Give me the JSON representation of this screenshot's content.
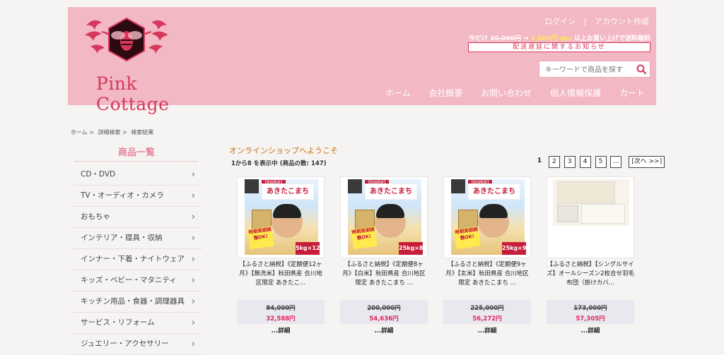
{
  "header": {
    "brand": "Pink Cottage",
    "login": "ログイン",
    "separator": "|",
    "create_account": "アカウント作成",
    "shipping_prefix": "今だけ",
    "shipping_old": "10,000円",
    "shipping_plus": "→",
    "shipping_new": "1,500円",
    "shipping_tax": "(税込)",
    "shipping_suffix": "以上お買い上げで送料無料",
    "delay_notice": "配送遅延に関するお知らせ",
    "search_placeholder": "キーワードで商品を探す",
    "nav": [
      "ホーム",
      "会社概要",
      "お問い合わせ",
      "個人情報保護",
      "カート"
    ]
  },
  "breadcrumb": [
    "ホーム >",
    "詳細検索 >",
    "検索結果"
  ],
  "sidebar": {
    "title": "商品一覧",
    "items": [
      "CD・DVD",
      "TV・オーディオ・カメラ",
      "おもちゃ",
      "インテリア・寝具・収納",
      "インナー・下着・ナイトウェア",
      "キッズ・ベビー・マタニティ",
      "キッチン用品・食器・調理器具",
      "サービス・リフォーム",
      "ジュエリー・アクセサリー"
    ],
    "arrow": "›"
  },
  "main": {
    "welcome": "オンラインショップへようこそ",
    "count": "1から8 を表示中 (商品の数: 147)",
    "pager": {
      "current": "1",
      "pages": [
        "2",
        "3",
        "4",
        "5"
      ],
      "ellipsis": "...",
      "next": "[次へ >>]"
    },
    "products": [
      {
        "name": "【ふるさと納税】《定期便12ヶ月》【無洗米】秋田県産 合川地区限定 あきたこ...",
        "thumb_title": "あきたこまち",
        "thumb_tag": "【秋田県産】",
        "thumb_badge": "時期周期調整OK!",
        "thumb_weight": "5kg×12",
        "old_price": "84,000円",
        "price": "32,588円",
        "detail": "...詳細"
      },
      {
        "name": "【ふるさと納税】《定期便8ヶ月》【白米】秋田県産 合川地区限定 あきたこまち ...",
        "thumb_title": "あきたこまち",
        "thumb_tag": "【秋田県産】",
        "thumb_badge": "時期周期調整OK!",
        "thumb_weight": "25kg×8",
        "old_price": "200,000円",
        "price": "54,636円",
        "detail": "...詳細"
      },
      {
        "name": "【ふるさと納税】《定期便9ヶ月》【玄米】秋田県産 合川地区限定 あきたこまち ...",
        "thumb_title": "あきたこまち",
        "thumb_tag": "【秋田県産】",
        "thumb_badge": "時期周期調整OK!",
        "thumb_weight": "25kg×9",
        "old_price": "225,000円",
        "price": "56,272円",
        "detail": "...詳細"
      },
      {
        "name": "【ふるさと納税】【シングルサイズ】オールシーズン2枚合せ羽毛布団（掛けカバ...",
        "old_price": "173,000円",
        "price": "57,305円",
        "detail": "...詳細"
      }
    ]
  },
  "colors": {
    "header_bg": "#f2b8c4",
    "brand": "#d7375a",
    "welcome": "#c8730e",
    "price": "#e0245a"
  }
}
